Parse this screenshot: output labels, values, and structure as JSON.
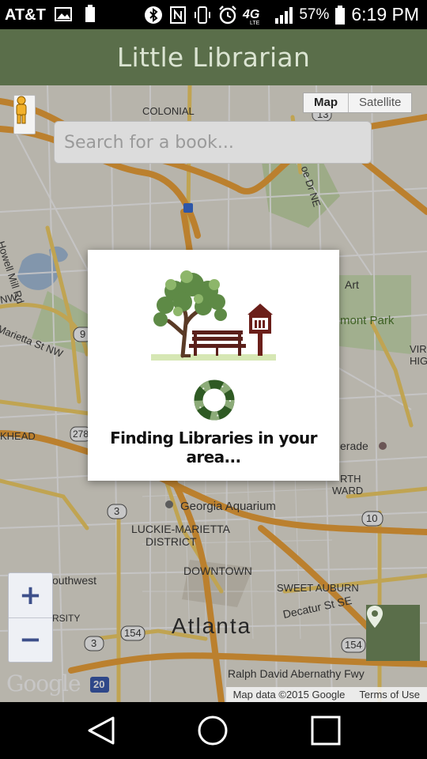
{
  "status_bar": {
    "carrier": "AT&T",
    "network": "4G",
    "battery": "57%",
    "time": "6:19 PM"
  },
  "app": {
    "title": "Little Librarian",
    "accent_color": "#5a6e4a"
  },
  "map": {
    "type_toggle": {
      "map_label": "Map",
      "satellite_label": "Satellite"
    },
    "search_placeholder": "Search for a book...",
    "zoom_in_label": "+",
    "zoom_out_label": "−",
    "logo": "Google",
    "attribution": "Map data ©2015 Google",
    "terms": "Terms of Use",
    "labels": {
      "colonial": "COLONIAL",
      "howell_mill": "Howell Mill Rd",
      "nw": "NW",
      "marietta": "Marietta St NW",
      "khead": "KHEAD",
      "art": "Art",
      "piedmont": "mont Park",
      "vir": "VIR",
      "hig": "HIG",
      "erade": "erade",
      "north": "RTH",
      "ward": "WARD",
      "aquarium": "Georgia Aquarium",
      "luckie": "LUCKIE-MARIETTA",
      "district": "DISTRICT",
      "downtown": "DOWNTOWN",
      "sweet_auburn": "SWEET AUBURN",
      "southwest": "outhwest",
      "atlanta": "Atlanta",
      "decatur": "Decatur St SE",
      "abernathy": "Ralph David Abernathy Fwy",
      "oe_dr": "oe Dr NE",
      "rsity": "RSITY",
      "r3": "3",
      "r10": "10",
      "r13": "13",
      "r154a": "154",
      "r154b": "154",
      "r278": "278",
      "r20": "20",
      "r9": "9",
      "r3b": "3"
    }
  },
  "dialog": {
    "message": "Finding Libraries in your area..."
  }
}
